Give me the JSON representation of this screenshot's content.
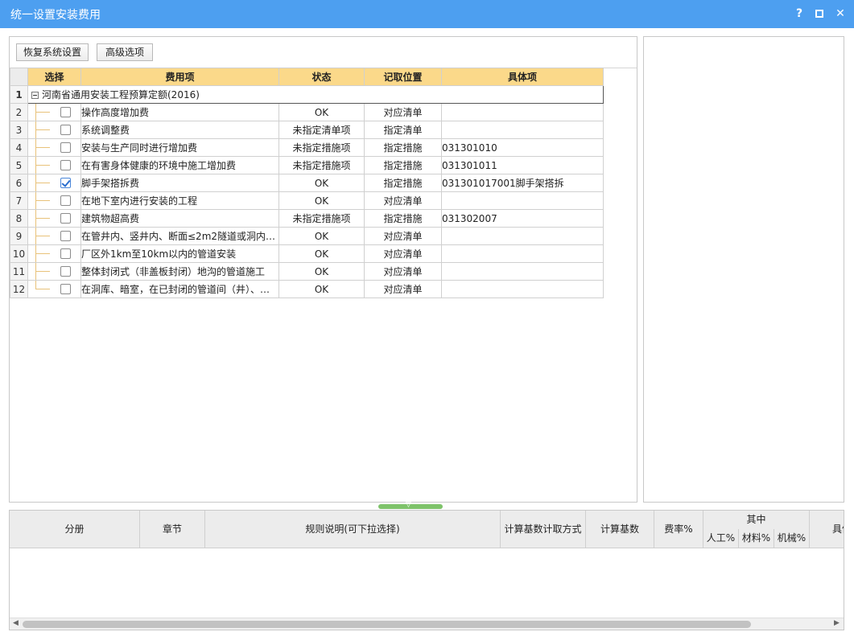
{
  "window": {
    "title": "统一设置安装费用",
    "help_label": "?",
    "restore_label": "□",
    "close_label": "✕"
  },
  "toolbar": {
    "restore_defaults_label": "恢复系统设置",
    "advanced_label": "高级选项"
  },
  "grid": {
    "columns": [
      "选择",
      "费用项",
      "状态",
      "记取位置",
      "具体项"
    ],
    "group_row": {
      "num": "1",
      "title": "河南省通用安装工程预算定额(2016)"
    },
    "rows": [
      {
        "num": "2",
        "checked": false,
        "name": "操作高度增加费",
        "status": "OK",
        "location": "对应清单",
        "detail": ""
      },
      {
        "num": "3",
        "checked": false,
        "name": "系统调整费",
        "status": "未指定清单项",
        "location": "指定清单",
        "detail": ""
      },
      {
        "num": "4",
        "checked": false,
        "name": "安装与生产同时进行增加费",
        "status": "未指定措施项",
        "location": "指定措施",
        "detail": "031301010"
      },
      {
        "num": "5",
        "checked": false,
        "name": "在有害身体健康的环境中施工增加费",
        "status": "未指定措施项",
        "location": "指定措施",
        "detail": "031301011"
      },
      {
        "num": "6",
        "checked": true,
        "name": "脚手架搭拆费",
        "status": "OK",
        "location": "指定措施",
        "detail": "031301017001脚手架搭拆"
      },
      {
        "num": "7",
        "checked": false,
        "name": "在地下室内进行安装的工程",
        "status": "OK",
        "location": "对应清单",
        "detail": ""
      },
      {
        "num": "8",
        "checked": false,
        "name": "建筑物超高费",
        "status": "未指定措施项",
        "location": "指定措施",
        "detail": "031302007"
      },
      {
        "num": "9",
        "checked": false,
        "name": "在管井内、竖井内、断面≤2m2隧道或洞内…",
        "status": "OK",
        "location": "对应清单",
        "detail": ""
      },
      {
        "num": "10",
        "checked": false,
        "name": "厂区外1km至10km以内的管道安装",
        "status": "OK",
        "location": "对应清单",
        "detail": ""
      },
      {
        "num": "11",
        "checked": false,
        "name": "整体封闭式（非盖板封闭）地沟的管道施工",
        "status": "OK",
        "location": "对应清单",
        "detail": ""
      },
      {
        "num": "12",
        "checked": false,
        "name": "在洞库、暗室，在已封闭的管道间（井）、…",
        "status": "OK",
        "location": "对应清单",
        "detail": ""
      }
    ]
  },
  "bottom": {
    "columns": {
      "volume": "分册",
      "chapter": "章节",
      "rule": "规则说明(可下拉选择)",
      "base_method": "计算基数计取方式",
      "base": "计算基数",
      "rate": "费率%",
      "among": "其中",
      "labor": "人工%",
      "material": "材料%",
      "machine": "机械%",
      "specific": "具体"
    }
  },
  "colors": {
    "titlebar": "#4d9ff0",
    "header": "#fbd98a",
    "splitter": "#7ec36a"
  }
}
